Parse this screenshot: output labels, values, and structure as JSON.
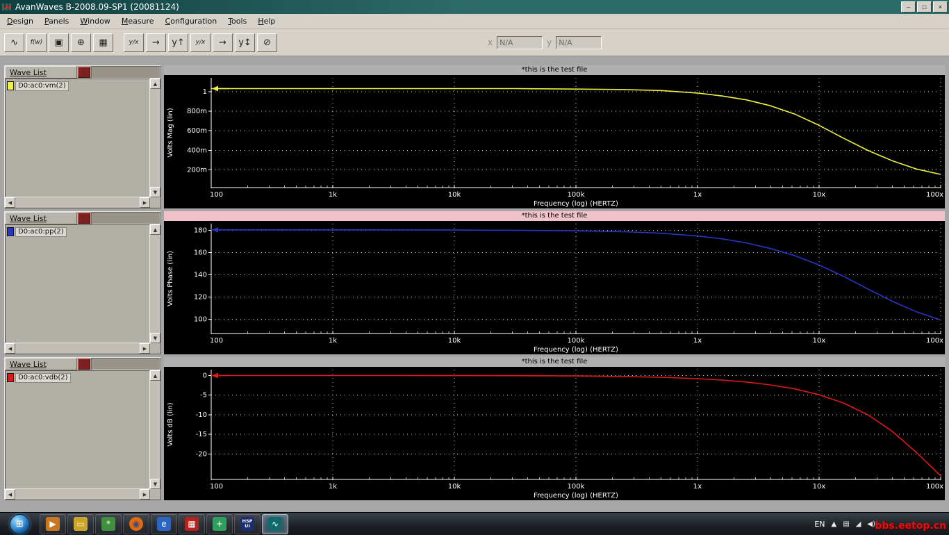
{
  "window": {
    "title": "AvanWaves B-2008.09-SP1 (20081124)",
    "controls": {
      "minimize": "–",
      "maximize": "□",
      "close": "×"
    }
  },
  "menu": {
    "items": [
      {
        "label": "Design"
      },
      {
        "label": "Panels"
      },
      {
        "label": "Window"
      },
      {
        "label": "Measure"
      },
      {
        "label": "Configuration"
      },
      {
        "label": "Tools"
      },
      {
        "label": "Help"
      }
    ]
  },
  "toolbar": {
    "x_label": "x",
    "y_label": "y",
    "x_value": "N/A",
    "y_value": "N/A",
    "icons": [
      {
        "name": "waveform-panel-icon",
        "glyph": "∿"
      },
      {
        "name": "expression-builder-icon",
        "glyph": "f(w)"
      },
      {
        "name": "print-icon",
        "glyph": "▣"
      },
      {
        "name": "zoom-fit-icon",
        "glyph": "⊕"
      },
      {
        "name": "add-panel-icon",
        "glyph": "▦"
      },
      {
        "name": "slope-measure-icon",
        "glyph": "y/x"
      },
      {
        "name": "x-cursor-icon",
        "glyph": "→"
      },
      {
        "name": "y-measure-icon",
        "glyph": "y↑"
      },
      {
        "name": "ratio-measure-icon",
        "glyph": "y/x"
      },
      {
        "name": "x-marker-icon",
        "glyph": "→"
      },
      {
        "name": "y-range-icon",
        "glyph": "y↕"
      },
      {
        "name": "clear-measures-icon",
        "glyph": "⊘"
      }
    ]
  },
  "panels": [
    {
      "wave_list_title": "Wave List",
      "items": [
        {
          "label": "D0:ac0:vm(2)",
          "color": "#f2f23a"
        }
      ]
    },
    {
      "wave_list_title": "Wave List",
      "items": [
        {
          "label": "D0:ac0:pp(2)",
          "color": "#2a35c0"
        }
      ]
    },
    {
      "wave_list_title": "Wave List",
      "items": [
        {
          "label": "D0:ac0:vdb(2)",
          "color": "#e01818"
        }
      ]
    }
  ],
  "chart_data": [
    {
      "type": "line",
      "x_scale": "log",
      "title": "*this is the test file",
      "title_bg": "#b0b0b0",
      "xlabel": "Frequency (log) (HERTZ)",
      "ylabel": "Volts Mag (lin)",
      "xlim": [
        0,
        6
      ],
      "ylim": [
        0.02,
        1.14
      ],
      "grid": true,
      "start_arrow": true,
      "x_ticks": {
        "positions": [
          0,
          1,
          2,
          3,
          4,
          5,
          6
        ],
        "labels": [
          "100",
          "1k",
          "10k",
          "100k",
          "1x",
          "10x",
          "100x"
        ]
      },
      "y_ticks": {
        "values": [
          1,
          0.8,
          0.6,
          0.4,
          0.2
        ],
        "labels": [
          "1",
          "800m",
          "600m",
          "400m",
          "200m"
        ]
      },
      "series": [
        {
          "name": "D0:ac0:vm(2)",
          "color": "#f2f23a",
          "x": [
            0,
            0.5,
            1,
            1.5,
            2,
            2.5,
            3,
            3.4,
            3.7,
            4,
            4.2,
            4.4,
            4.6,
            4.8,
            5,
            5.2,
            5.4,
            5.6,
            5.8,
            6
          ],
          "values": [
            1.03,
            1.03,
            1.03,
            1.03,
            1.03,
            1.03,
            1.025,
            1.02,
            1.01,
            0.985,
            0.955,
            0.915,
            0.855,
            0.77,
            0.655,
            0.525,
            0.4,
            0.295,
            0.21,
            0.155
          ]
        }
      ]
    },
    {
      "type": "line",
      "x_scale": "log",
      "title": "*this is the test file",
      "title_bg": "#f0c2ca",
      "xlabel": "Frequency (log) (HERTZ)",
      "ylabel": "Volts Phase (lin)",
      "xlim": [
        0,
        6
      ],
      "ylim": [
        87,
        186
      ],
      "grid": true,
      "start_arrow": true,
      "x_ticks": {
        "positions": [
          0,
          1,
          2,
          3,
          4,
          5,
          6
        ],
        "labels": [
          "100",
          "1k",
          "10k",
          "100k",
          "1x",
          "10x",
          "100x"
        ]
      },
      "y_ticks": {
        "values": [
          180,
          160,
          140,
          120,
          100
        ],
        "labels": [
          "180",
          "160",
          "140",
          "120",
          "100"
        ]
      },
      "series": [
        {
          "name": "D0:ac0:pp(2)",
          "color": "#2a35c0",
          "x": [
            0,
            0.5,
            1,
            1.5,
            2,
            2.5,
            3,
            3.4,
            3.7,
            4,
            4.2,
            4.4,
            4.6,
            4.8,
            5,
            5.2,
            5.4,
            5.6,
            5.8,
            6
          ],
          "values": [
            180.5,
            180.5,
            180.5,
            180.4,
            180.3,
            180.1,
            179.6,
            178.8,
            177.4,
            175,
            172.4,
            168.8,
            163.6,
            157.2,
            148.8,
            138.6,
            127.2,
            116.2,
            106.6,
            99.2
          ]
        }
      ]
    },
    {
      "type": "line",
      "x_scale": "log",
      "title": "*this is the test file",
      "title_bg": "#b0b0b0",
      "xlabel": "Frequency (log) (HERTZ)",
      "ylabel": "Volts dB (lin)",
      "xlim": [
        0,
        6
      ],
      "ylim": [
        -26.5,
        1.5
      ],
      "grid": true,
      "start_arrow": true,
      "x_ticks": {
        "positions": [
          0,
          1,
          2,
          3,
          4,
          5,
          6
        ],
        "labels": [
          "100",
          "1k",
          "10k",
          "100k",
          "1x",
          "10x",
          "100x"
        ]
      },
      "y_ticks": {
        "values": [
          0,
          -5,
          -10,
          -15,
          -20
        ],
        "labels": [
          "0",
          "-5",
          "-10",
          "-15",
          "-20"
        ]
      },
      "series": [
        {
          "name": "D0:ac0:vdb(2)",
          "color": "#e01818",
          "x": [
            0,
            0.5,
            1,
            1.5,
            2,
            2.5,
            3,
            3.4,
            3.7,
            4,
            4.2,
            4.4,
            4.6,
            4.8,
            5,
            5.2,
            5.4,
            5.6,
            5.8,
            6
          ],
          "values": [
            0,
            0,
            0,
            0,
            -0.02,
            -0.05,
            -0.12,
            -0.25,
            -0.45,
            -0.8,
            -1.15,
            -1.65,
            -2.4,
            -3.4,
            -4.9,
            -7.0,
            -10.0,
            -14.2,
            -19.6,
            -25.6
          ]
        }
      ]
    }
  ],
  "taskbar": {
    "items": [
      {
        "name": "taskbar-media-player",
        "glyph": "▶",
        "bg": "#c87820",
        "fg": "#fff"
      },
      {
        "name": "taskbar-explorer",
        "glyph": "▭",
        "bg": "#caa52c",
        "fg": "#f7e9b0"
      },
      {
        "name": "taskbar-green-tool",
        "glyph": "*",
        "bg": "#3f8f3f",
        "fg": "#fff"
      },
      {
        "name": "taskbar-firefox",
        "glyph": "◉",
        "bg": "#e06a10",
        "fg": "#2a4a8f",
        "round": true
      },
      {
        "name": "taskbar-internet-explorer",
        "glyph": "e",
        "bg": "#2b66c4",
        "fg": "#fff"
      },
      {
        "name": "taskbar-red-grid-app",
        "glyph": "▦",
        "bg": "#b6221e",
        "fg": "#fff"
      },
      {
        "name": "taskbar-green-blue-app",
        "glyph": "+",
        "bg": "#2f9f5f",
        "fg": "#fff"
      },
      {
        "name": "taskbar-hspice-ui",
        "glyph": "HSP\nUI",
        "bg": "#1c2e6e",
        "fg": "#fff",
        "small": true
      },
      {
        "name": "taskbar-avanwaves",
        "glyph": "∿",
        "bg": "#0f6b6b",
        "fg": "#fff",
        "active": true
      }
    ],
    "tray": {
      "language": "EN",
      "icons": [
        {
          "name": "tray-expand-icon",
          "glyph": "▲"
        },
        {
          "name": "action-center-icon",
          "glyph": "▤"
        },
        {
          "name": "network-icon",
          "glyph": "◢"
        },
        {
          "name": "volume-icon",
          "glyph": "◀)"
        }
      ]
    },
    "watermark": "bbs.eetop.cn"
  }
}
